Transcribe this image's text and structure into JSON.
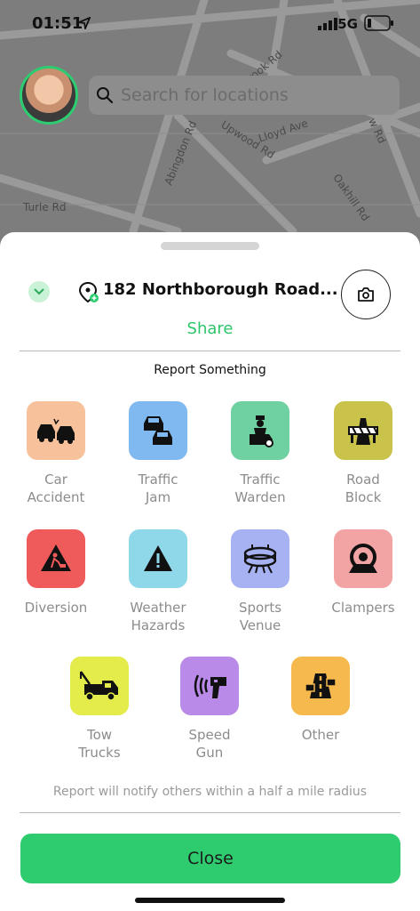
{
  "status_bar": {
    "time": "01:51",
    "network": "5G"
  },
  "search": {
    "placeholder": "Search for locations"
  },
  "map": {
    "road_labels": [
      "Brook Rd",
      "Lloyd Ave",
      "Upwood Rd",
      "Abingdon Rd",
      "Oakhill Rd",
      "Turle Rd",
      "w Rd"
    ]
  },
  "sheet": {
    "address": "182 Northborough Road...",
    "share_label": "Share",
    "section_title": "Report Something",
    "items": [
      {
        "label": "Car\nAccident",
        "icon": "car-accident-icon",
        "color": "#f7c29b"
      },
      {
        "label": "Traffic\nJam",
        "icon": "traffic-jam-icon",
        "color": "#7fb9f0"
      },
      {
        "label": "Traffic\nWarden",
        "icon": "traffic-warden-icon",
        "color": "#6fd1a1"
      },
      {
        "label": "Road\nBlock",
        "icon": "road-block-icon",
        "color": "#c9c24b"
      },
      {
        "label": "Diversion",
        "icon": "diversion-icon",
        "color": "#ef5a5a"
      },
      {
        "label": "Weather\nHazards",
        "icon": "weather-hazard-icon",
        "color": "#8fd8ea"
      },
      {
        "label": "Sports\nVenue",
        "icon": "sports-venue-icon",
        "color": "#a7b2f2"
      },
      {
        "label": "Clampers",
        "icon": "clamp-icon",
        "color": "#f2a3a3"
      },
      {
        "label": "Tow\nTrucks",
        "icon": "tow-truck-icon",
        "color": "#e3ec4a"
      },
      {
        "label": "Speed\nGun",
        "icon": "speed-gun-icon",
        "color": "#b98ae8"
      },
      {
        "label": "Other",
        "icon": "road-icon",
        "color": "#f5b94d"
      }
    ],
    "note": "Report will notify others within a half a mile radius",
    "close_label": "Close"
  }
}
